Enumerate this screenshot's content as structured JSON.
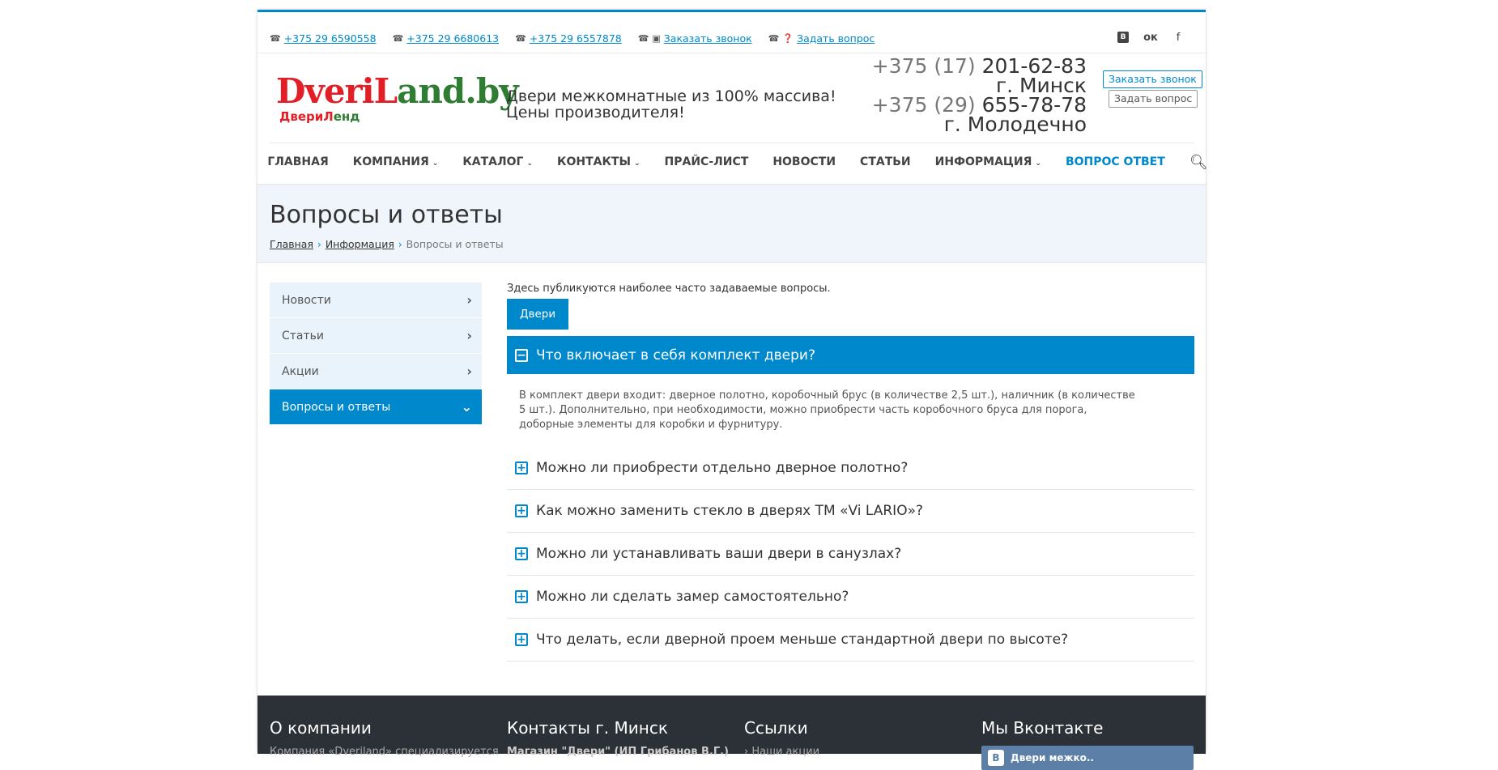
{
  "topbar": {
    "phones": [
      "+375 29 6590558",
      "+375 29 6680613",
      "+375 29 6557878"
    ],
    "call_label": "Заказать звонок",
    "ask_label": "Задать вопрос",
    "social": {
      "vk": "В",
      "ok": "ок",
      "fb": "f"
    }
  },
  "header": {
    "logo_main_1": "Dveri",
    "logo_main_2": "L",
    "logo_main_3": "and.by",
    "logo_sub_1": "Двери",
    "logo_sub_2": "Л",
    "logo_sub_3": "енд",
    "slogan_line1": "Двери межкомнатные из 100% массива!",
    "slogan_line2": "Цены производителя!",
    "phone1_code": "+375 (17)",
    "phone1_num": "201-62-83",
    "city1": "г. Минск",
    "phone2_code": "+375 (29)",
    "phone2_num": "655-78-78",
    "city2": "г. Молодечно",
    "btn_call": "Заказать звонок",
    "btn_ask": "Задать вопрос"
  },
  "nav": {
    "items": [
      {
        "label": "ГЛАВНАЯ"
      },
      {
        "label": "КОМПАНИЯ"
      },
      {
        "label": "КАТАЛОГ"
      },
      {
        "label": "КОНТАКТЫ"
      },
      {
        "label": "ПРАЙС-ЛИСТ"
      },
      {
        "label": "НОВОСТИ"
      },
      {
        "label": "СТАТЬИ"
      },
      {
        "label": "ИНФОРМАЦИЯ"
      },
      {
        "label": "ВОПРОС ОТВЕТ"
      }
    ]
  },
  "page": {
    "title": "Вопросы и ответы",
    "breadcrumb": [
      "Главная",
      "Информация",
      "Вопросы и ответы"
    ]
  },
  "sidebar": {
    "items": [
      {
        "label": "Новости"
      },
      {
        "label": "Статьи"
      },
      {
        "label": "Акции"
      },
      {
        "label": "Вопросы и ответы"
      }
    ]
  },
  "content": {
    "intro": "Здесь публикуются наиболее часто задаваемые вопросы.",
    "category_button": "Двери",
    "questions": [
      {
        "q": "Что включает в себя комплект двери?",
        "a": "В комплект двери входит: дверное полотно, коробочный брус (в количестве 2,5 шт.), наличник (в количестве 5 шт.). Дополнительно, при необходимости, можно приобрести часть коробочного бруса для порога, доборные элементы для коробки и фурнитуру."
      },
      {
        "q": "Можно ли приобрести отдельно дверное полотно?"
      },
      {
        "q": "Как можно заменить стекло в дверях ТМ «Vi LARIO»?"
      },
      {
        "q": "Можно ли устанавливать ваши двери в санузлах?"
      },
      {
        "q": "Можно ли сделать замер самостоятельно?"
      },
      {
        "q": "Что делать, если дверной проем меньше стандартной двери по высоте?"
      }
    ]
  },
  "footer": {
    "col1_title": "О компании",
    "col1_text": "Компания «Dveriland» специализируется",
    "col2_title": "Контакты г. Минск",
    "col2_text": "Магазин \"Двери\" (ИП Грибанов В.Г.)",
    "col3_title": "Ссылки",
    "col3_text": "Наши акции",
    "col4_title": "Мы Вконтакте",
    "vk_widget_label": "Двери межко..",
    "vk_widget_icon": "В"
  },
  "colors": {
    "accent": "#0088cc",
    "logo_green": "#2e7d32",
    "logo_red": "#e21e26",
    "footer_bg": "#2c3137"
  }
}
